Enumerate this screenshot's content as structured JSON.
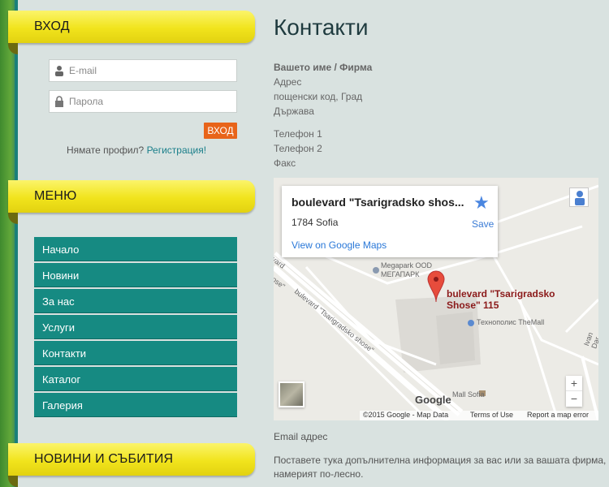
{
  "sidebar": {
    "login": {
      "title": "ВХОД",
      "email_placeholder": "E-mail",
      "password_placeholder": "Парола",
      "button": "ВХОД",
      "no_profile_text": "Нямате профил?",
      "register_link": "Регистрация!"
    },
    "menu": {
      "title": "МЕНЮ",
      "items": [
        {
          "label": "Начало"
        },
        {
          "label": "Новини"
        },
        {
          "label": "За нас"
        },
        {
          "label": "Услуги"
        },
        {
          "label": "Контакти"
        },
        {
          "label": "Каталог"
        },
        {
          "label": "Галерия"
        }
      ]
    },
    "news": {
      "title": "НОВИНИ И СЪБИТИЯ"
    }
  },
  "main": {
    "title": "Контакти",
    "address": {
      "name": "Вашето име / Фирма",
      "street": "Адрес",
      "postal": "пощенски код, Град",
      "country": "Държава"
    },
    "phones": {
      "phone1": "Телефон 1",
      "phone2": "Телефон 2",
      "fax": "Факс"
    },
    "email": "Email адрес",
    "extra_info": "Поставете тука допълнителна информация за вас или за вашата фирма, намерият по-лесно."
  },
  "map": {
    "card": {
      "title": "boulevard \"Tsarigradsko shos...",
      "subtitle": "1784 Sofia",
      "link": "View on Google Maps",
      "save": "Save"
    },
    "place_label_line1": "bulevard \"Tsarigradsko",
    "place_label_line2": "Shose\" 115",
    "labels": {
      "megapark": "Megapark OOD",
      "megapark_cyr": "МЕГАПАРК",
      "technopolis": "Технополис TheMall",
      "mall_sofia": "Mall Sofia",
      "road1": "bulevard \"Tsarigradsko shose\"",
      "road_prefix": "vard",
      "road_cut": "ose\"",
      "road_ivan": "Ivan Dar",
      "google": "Google"
    },
    "zoom_in": "+",
    "zoom_out": "−",
    "attribution": {
      "data": "©2015 Google - Map Data",
      "terms": "Terms of Use",
      "report": "Report a map error"
    }
  }
}
